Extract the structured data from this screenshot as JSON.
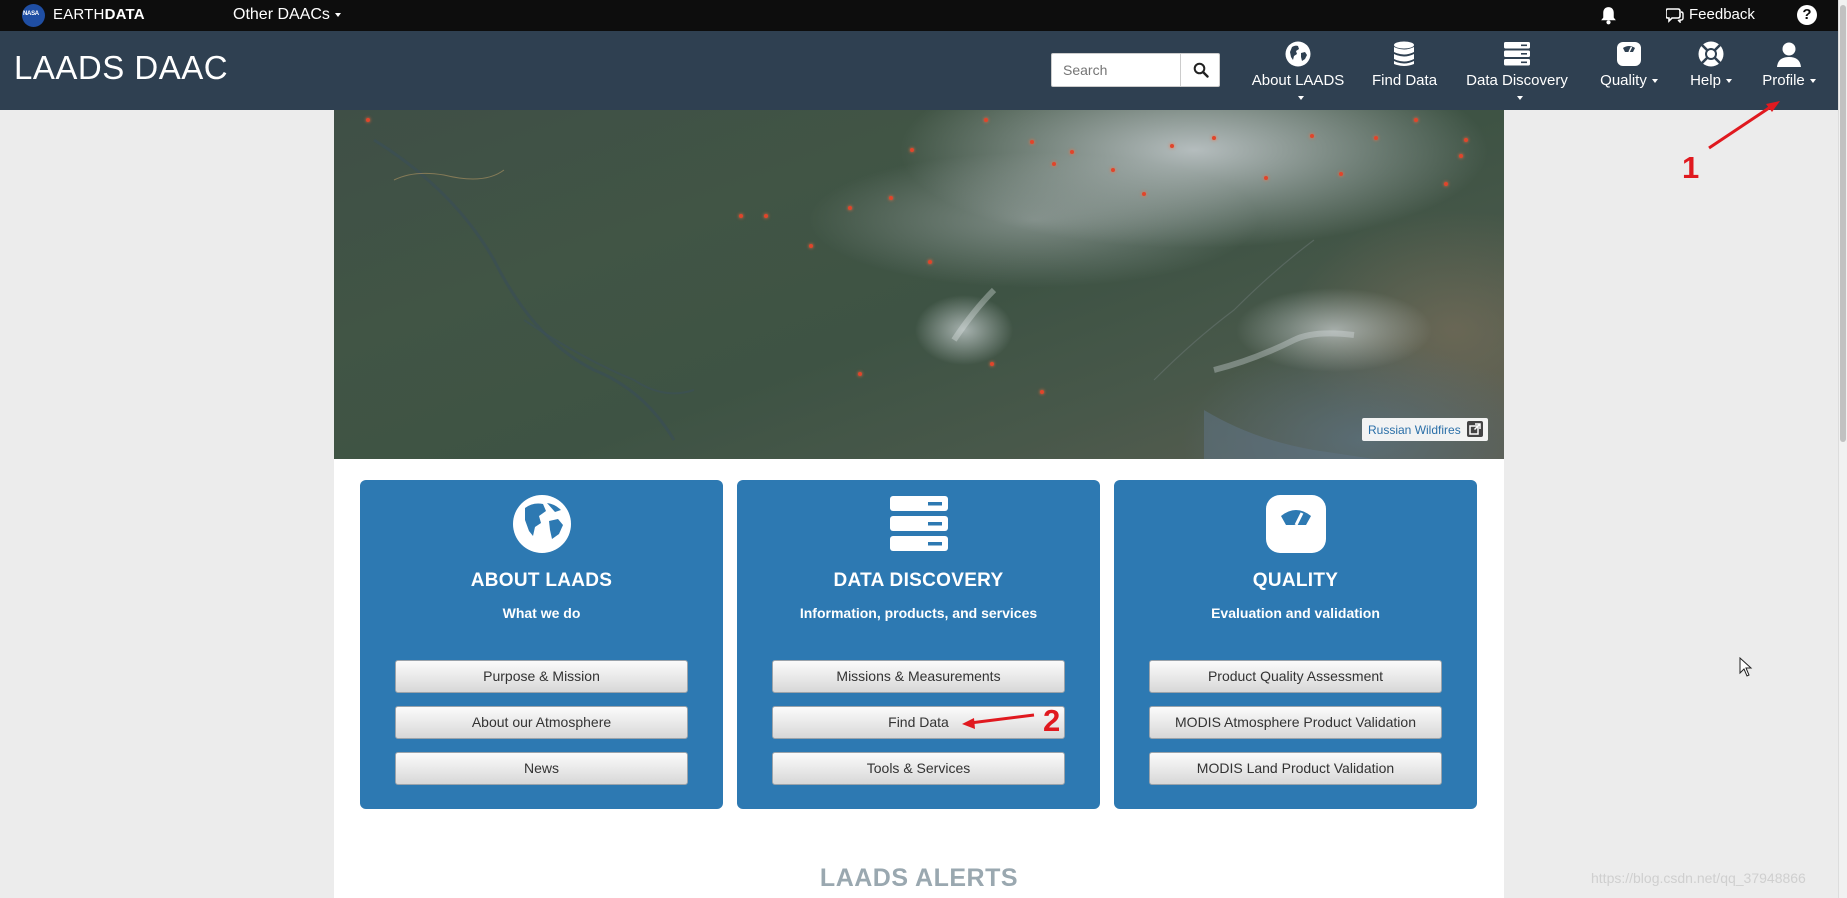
{
  "topbar": {
    "brand_light": "EARTH",
    "brand_bold": "DATA",
    "other_daacs": "Other DAACs",
    "feedback": "Feedback",
    "help_glyph": "?"
  },
  "navbar": {
    "title": "LAADS DAAC",
    "search_placeholder": "Search",
    "items": [
      {
        "label": "About LAADS",
        "icon": "globe-icon",
        "dropdown": true
      },
      {
        "label": "Find Data",
        "icon": "database-icon",
        "dropdown": false
      },
      {
        "label": "Data Discovery",
        "icon": "server-icon",
        "dropdown": true
      },
      {
        "label": "Quality",
        "icon": "scale-icon",
        "dropdown": true
      },
      {
        "label": "Help",
        "icon": "lifebuoy-icon",
        "dropdown": true
      },
      {
        "label": "Profile",
        "icon": "user-icon",
        "dropdown": true
      }
    ]
  },
  "hero": {
    "credit": "Russian Wildfires"
  },
  "cards": [
    {
      "title": "ABOUT LAADS",
      "subtitle": "What we do",
      "icon": "globe-icon",
      "buttons": [
        "Purpose & Mission",
        "About our Atmosphere",
        "News"
      ]
    },
    {
      "title": "DATA DISCOVERY",
      "subtitle": "Information, products, and services",
      "icon": "server-icon",
      "buttons": [
        "Missions & Measurements",
        "Find Data",
        "Tools & Services"
      ]
    },
    {
      "title": "QUALITY",
      "subtitle": "Evaluation and validation",
      "icon": "scale-icon",
      "buttons": [
        "Product Quality Assessment",
        "MODIS Atmosphere Product Validation",
        "MODIS Land Product Validation"
      ]
    }
  ],
  "alerts_heading": "LAADS ALERTS",
  "annotations": {
    "one": "1",
    "two": "2"
  },
  "watermark": "https://blog.csdn.net/qq_37948866",
  "colors": {
    "navbar": "#2f4051",
    "card": "#2d79b2",
    "annotation": "#e0191f"
  }
}
